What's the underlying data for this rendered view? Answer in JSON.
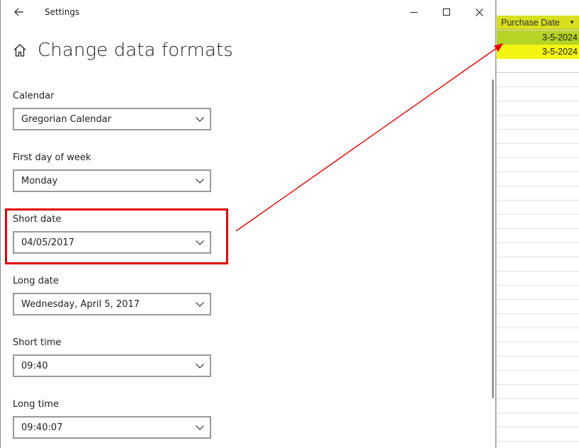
{
  "window": {
    "title": "Settings",
    "back_icon": "arrow-left-icon",
    "controls": [
      "minimize-icon",
      "maximize-icon",
      "close-icon"
    ]
  },
  "page": {
    "title": "Change data formats",
    "icon": "home-icon"
  },
  "fields": [
    {
      "label": "Calendar",
      "value": "Gregorian Calendar"
    },
    {
      "label": "First day of week",
      "value": "Monday"
    },
    {
      "label": "Short date",
      "value": "04/05/2017"
    },
    {
      "label": "Long date",
      "value": "Wednesday, April 5, 2017"
    },
    {
      "label": "Short time",
      "value": "09:40"
    },
    {
      "label": "Long time",
      "value": "09:40:07"
    }
  ],
  "spreadsheet": {
    "column_header": "Purchase Date",
    "rows": [
      "3-5-2024",
      "3-5-2024"
    ],
    "colors": {
      "header": "#d7df1f",
      "row1": "#b6d326",
      "row2": "#f4f413"
    }
  },
  "annotation": {
    "color": "#e00000",
    "target_field": "Short date"
  }
}
